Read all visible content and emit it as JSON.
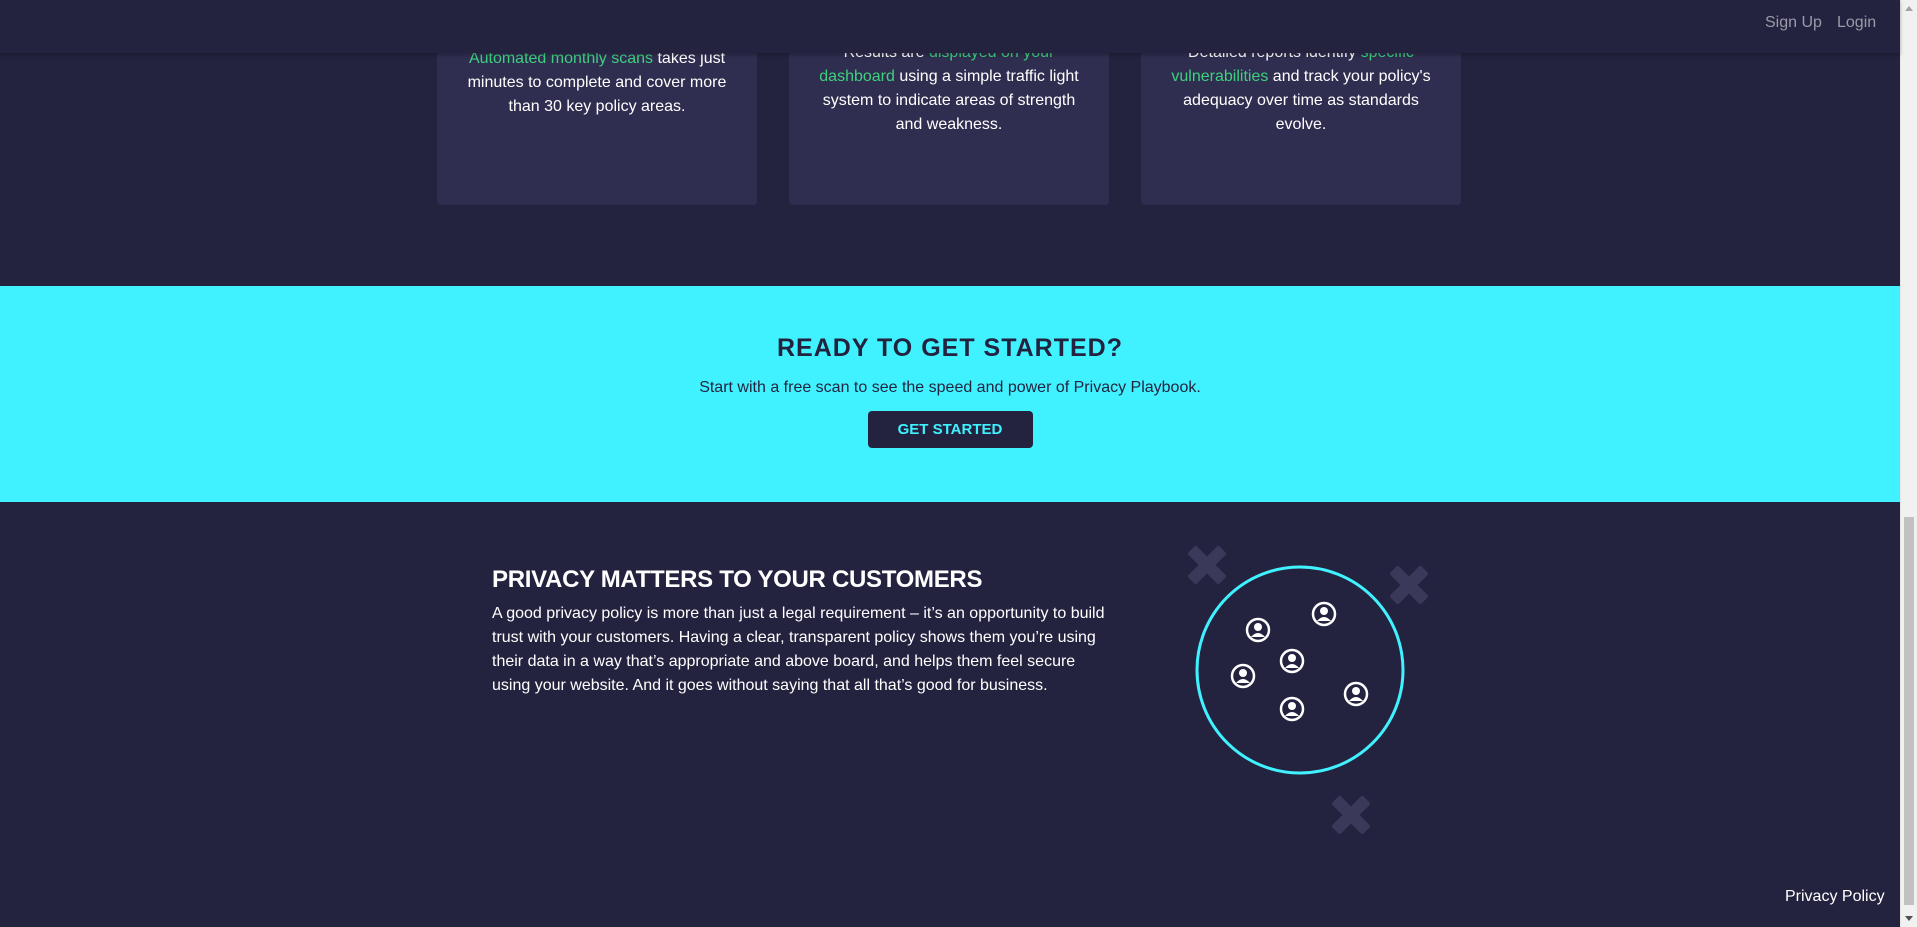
{
  "nav": {
    "signup": "Sign Up",
    "login": "Login"
  },
  "cards": [
    {
      "hl1": "Automated monthly scans",
      "t1": " takes just minutes to complete and cover more than 30 key policy areas.",
      "hl2": "",
      "t2": ""
    },
    {
      "t0": "Results are ",
      "hl1": "displayed on your dashboard",
      "t1": " using a simple traffic light system to indicate areas of strength and weakness."
    },
    {
      "t0": "Detailed reports identify ",
      "hl1": "specific vulnerabilities",
      "t1": " and track your policy's adequacy over time as standards evolve."
    }
  ],
  "cta": {
    "title": "READY TO GET STARTED?",
    "text": "Start with a free scan to see the speed and power of Privacy Playbook.",
    "button": "GET STARTED"
  },
  "privacy": {
    "title": "PRIVACY MATTERS TO YOUR CUSTOMERS",
    "body": "A good privacy policy is more than just a legal requirement – it’s an opportunity to build trust with your customers. Having a clear, transparent policy shows them you’re using their data in a way that’s appropriate and above board, and helps them feel secure using your website. And it goes without saying that all that’s good for business."
  },
  "footer": {
    "privacy_policy": "Privacy Policy"
  },
  "colors": {
    "background": "#24233f",
    "accent": "#40f2ff",
    "highlight": "#3fd07e",
    "card": "#2f2e50"
  },
  "illustration": {
    "circle_icon": "users-circle-icon",
    "cross_icon": "x-mark-icon"
  }
}
